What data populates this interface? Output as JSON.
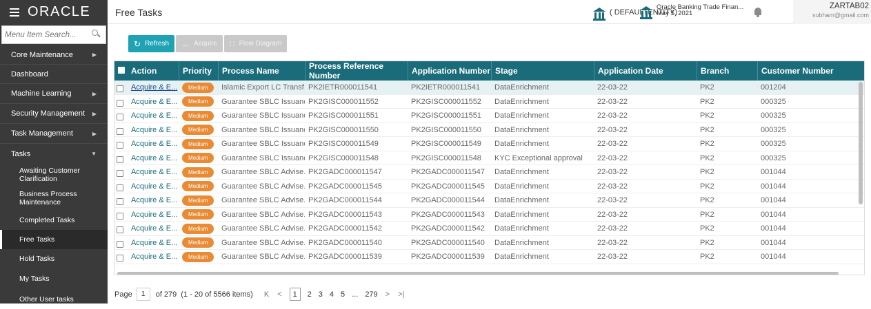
{
  "header": {
    "brand": "ORACLE",
    "page_title": "Free Tasks",
    "entity": "( DEFAULTENTITY)",
    "app_name": "Oracle Banking Trade Finan...",
    "app_date": "May 5, 2021",
    "user_name": "ZARTAB02",
    "user_email": "subham@gmail.com"
  },
  "sidebar": {
    "search_placeholder": "Menu Item Search...",
    "items": [
      {
        "label": "Core Maintenance",
        "arrow": "▶"
      },
      {
        "label": "Dashboard",
        "arrow": ""
      },
      {
        "label": "Machine Learning",
        "arrow": "▶"
      },
      {
        "label": "Security Management",
        "arrow": "▶"
      },
      {
        "label": "Task Management",
        "arrow": "▶"
      },
      {
        "label": "Tasks",
        "arrow": "▼"
      }
    ],
    "sub_items": [
      {
        "label": "Awaiting Customer Clarification"
      },
      {
        "label": "Business Process Maintenance"
      },
      {
        "label": "Completed Tasks"
      },
      {
        "label": "Free Tasks"
      },
      {
        "label": "Hold Tasks"
      },
      {
        "label": "My Tasks"
      },
      {
        "label": "Other User tasks"
      }
    ]
  },
  "toolbar": {
    "refresh": "Refresh",
    "acquire": "Acquire",
    "flow_diagram": "Flow Diagram"
  },
  "grid": {
    "columns": [
      "Action",
      "Priority",
      "Process Name",
      "Process Reference Number",
      "Application Number",
      "Stage",
      "Application Date",
      "Branch",
      "Customer Number"
    ],
    "rows": [
      {
        "action": "Acquire & E...",
        "priority": "Medium",
        "process": "Islamic Export LC Transf...",
        "ref": "PK2IETR000011541",
        "app": "PK2IETR000011541",
        "stage": "DataEnrichment",
        "date": "22-03-22",
        "branch": "PK2",
        "cust": "001204"
      },
      {
        "action": "Acquire & E...",
        "priority": "Medium",
        "process": "Guarantee SBLC Issuanc...",
        "ref": "PK2GISC000011552",
        "app": "PK2GISC000011552",
        "stage": "DataEnrichment",
        "date": "22-03-22",
        "branch": "PK2",
        "cust": "000325"
      },
      {
        "action": "Acquire & E...",
        "priority": "Medium",
        "process": "Guarantee SBLC Issuanc...",
        "ref": "PK2GISC000011551",
        "app": "PK2GISC000011551",
        "stage": "DataEnrichment",
        "date": "22-03-22",
        "branch": "PK2",
        "cust": "000325"
      },
      {
        "action": "Acquire & E...",
        "priority": "Medium",
        "process": "Guarantee SBLC Issuanc...",
        "ref": "PK2GISC000011550",
        "app": "PK2GISC000011550",
        "stage": "DataEnrichment",
        "date": "22-03-22",
        "branch": "PK2",
        "cust": "000325"
      },
      {
        "action": "Acquire & E...",
        "priority": "Medium",
        "process": "Guarantee SBLC Issuanc...",
        "ref": "PK2GISC000011549",
        "app": "PK2GISC000011549",
        "stage": "DataEnrichment",
        "date": "22-03-22",
        "branch": "PK2",
        "cust": "000325"
      },
      {
        "action": "Acquire & E...",
        "priority": "Medium",
        "process": "Guarantee SBLC Issuanc...",
        "ref": "PK2GISC000011548",
        "app": "PK2GISC000011548",
        "stage": "KYC Exceptional approval",
        "date": "22-03-22",
        "branch": "PK2",
        "cust": "000325"
      },
      {
        "action": "Acquire & E...",
        "priority": "Medium",
        "process": "Guarantee SBLC Advise...",
        "ref": "PK2GADC000011547",
        "app": "PK2GADC000011547",
        "stage": "DataEnrichment",
        "date": "22-03-22",
        "branch": "PK2",
        "cust": "001044"
      },
      {
        "action": "Acquire & E...",
        "priority": "Medium",
        "process": "Guarantee SBLC Advise...",
        "ref": "PK2GADC000011545",
        "app": "PK2GADC000011545",
        "stage": "DataEnrichment",
        "date": "22-03-22",
        "branch": "PK2",
        "cust": "001044"
      },
      {
        "action": "Acquire & E...",
        "priority": "Medium",
        "process": "Guarantee SBLC Advise...",
        "ref": "PK2GADC000011544",
        "app": "PK2GADC000011544",
        "stage": "DataEnrichment",
        "date": "22-03-22",
        "branch": "PK2",
        "cust": "001044"
      },
      {
        "action": "Acquire & E...",
        "priority": "Medium",
        "process": "Guarantee SBLC Advise...",
        "ref": "PK2GADC000011543",
        "app": "PK2GADC000011543",
        "stage": "DataEnrichment",
        "date": "22-03-22",
        "branch": "PK2",
        "cust": "001044"
      },
      {
        "action": "Acquire & E...",
        "priority": "Medium",
        "process": "Guarantee SBLC Advise...",
        "ref": "PK2GADC000011542",
        "app": "PK2GADC000011542",
        "stage": "DataEnrichment",
        "date": "22-03-22",
        "branch": "PK2",
        "cust": "001044"
      },
      {
        "action": "Acquire & E...",
        "priority": "Medium",
        "process": "Guarantee SBLC Advise...",
        "ref": "PK2GADC000011540",
        "app": "PK2GADC000011540",
        "stage": "DataEnrichment",
        "date": "22-03-22",
        "branch": "PK2",
        "cust": "001044"
      },
      {
        "action": "Acquire & E...",
        "priority": "Medium",
        "process": "Guarantee SBLC Advise...",
        "ref": "PK2GADC000011539",
        "app": "PK2GADC000011539",
        "stage": "DataEnrichment",
        "date": "22-03-22",
        "branch": "PK2",
        "cust": "001044"
      }
    ]
  },
  "pager": {
    "page_label": "Page",
    "current_page": "1",
    "of_label": "of 279",
    "items_label": "(1 - 20 of 5566 items)",
    "first": "K",
    "prev": "<",
    "pages": [
      "1",
      "2",
      "3",
      "4",
      "5",
      "...",
      "279"
    ],
    "next": ">",
    "last": ">|"
  },
  "colors": {
    "brand_dark": "#3a3a3a",
    "grid_header": "#1a6c7a",
    "accent": "#1fa3b4",
    "priority_medium": "#e98b35"
  }
}
